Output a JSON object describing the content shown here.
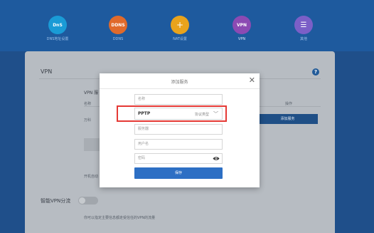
{
  "nav": {
    "items": [
      {
        "abbr": "DnS",
        "label": "DNS地址设置",
        "color": "#1a9bd6"
      },
      {
        "abbr": "DDNS",
        "label": "DDNS",
        "color": "#e06a2b"
      },
      {
        "abbr": "+",
        "label": "NAT设置",
        "color": "#e9a31c"
      },
      {
        "abbr": "VPN",
        "label": "VPN",
        "color": "#8c4ab3"
      },
      {
        "abbr": "☰",
        "label": "其他",
        "color": "#7b5fc7"
      }
    ]
  },
  "panel": {
    "title": "VPN",
    "vpn_sub": "VPN 服",
    "col_name": "名称",
    "col_action": "操作",
    "row_name": "万科",
    "add_button": "添加服务",
    "auto_text": "开机自动",
    "smart_title": "智能VPN分流",
    "desc": "你可以指定主要信息都走受信任的VPN的流量"
  },
  "modal": {
    "title": "添加服务",
    "name_placeholder": "名称",
    "protocol_value": "PPTP",
    "protocol_label": "协议类型",
    "server_placeholder": "服务器",
    "username_placeholder": "用户名",
    "password_placeholder": "密码",
    "save_label": "保存"
  }
}
